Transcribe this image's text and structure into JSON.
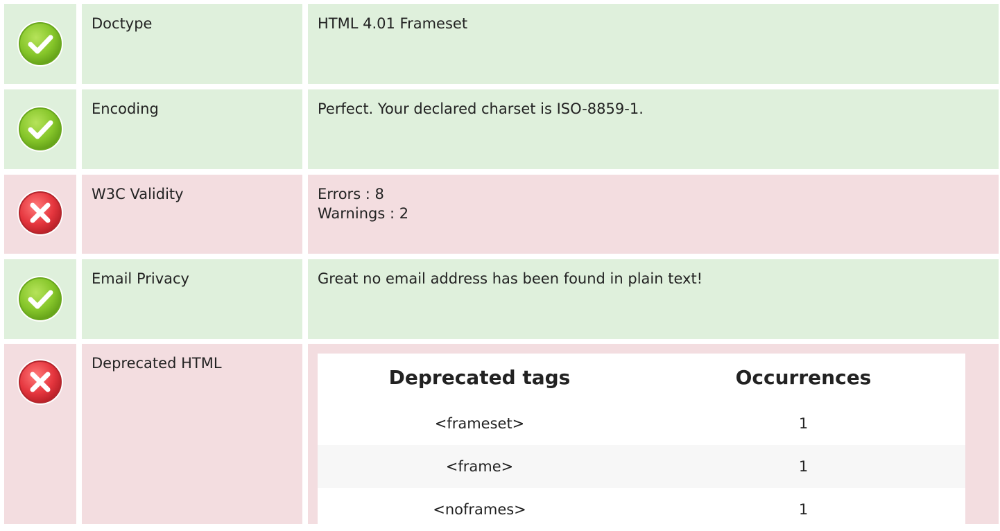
{
  "rows": {
    "doctype": {
      "label": "Doctype",
      "value": "HTML 4.01 Frameset",
      "status": "pass"
    },
    "encoding": {
      "label": "Encoding",
      "value": "Perfect. Your declared charset is ISO-8859-1.",
      "status": "pass"
    },
    "validity": {
      "label": "W3C Validity",
      "errors": "Errors : 8",
      "warnings": "Warnings : 2",
      "status": "fail"
    },
    "email": {
      "label": "Email Privacy",
      "value": "Great no email address has been found in plain text!",
      "status": "pass"
    },
    "deprecated": {
      "label": "Deprecated HTML",
      "status": "fail",
      "table": {
        "headers": [
          "Deprecated tags",
          "Occurrences"
        ],
        "rows": [
          [
            "<frameset>",
            "1"
          ],
          [
            "<frame>",
            "1"
          ],
          [
            "<noframes>",
            "1"
          ]
        ]
      }
    }
  },
  "colors": {
    "pass_bg": "#dff0dc",
    "fail_bg": "#f3dde0",
    "pass_icon": "#7cc22d",
    "fail_icon": "#e0323c"
  },
  "icons": {
    "pass": "check-circle-icon",
    "fail": "cross-circle-icon"
  }
}
